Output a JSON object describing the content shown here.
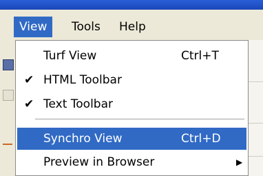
{
  "menubar": {
    "items": [
      {
        "label": "View",
        "active": true
      },
      {
        "label": "Tools",
        "active": false
      },
      {
        "label": "Help",
        "active": false
      }
    ]
  },
  "view_menu": {
    "items": [
      {
        "label": "Turf View",
        "shortcut": "Ctrl+T",
        "checked": false
      },
      {
        "label": "HTML Toolbar",
        "shortcut": "",
        "checked": true
      },
      {
        "label": "Text Toolbar",
        "shortcut": "",
        "checked": true
      },
      {
        "label": "Synchro View",
        "shortcut": "Ctrl+D",
        "checked": false,
        "highlighted": true
      },
      {
        "label": "Preview in Browser",
        "shortcut": "",
        "checked": false,
        "submenu": true
      }
    ],
    "check_glyph": "✔",
    "submenu_glyph": "▶"
  },
  "colors": {
    "highlight": "#316ac5",
    "menubar": "#ece9d8",
    "titlebar": "#1a46b8"
  }
}
